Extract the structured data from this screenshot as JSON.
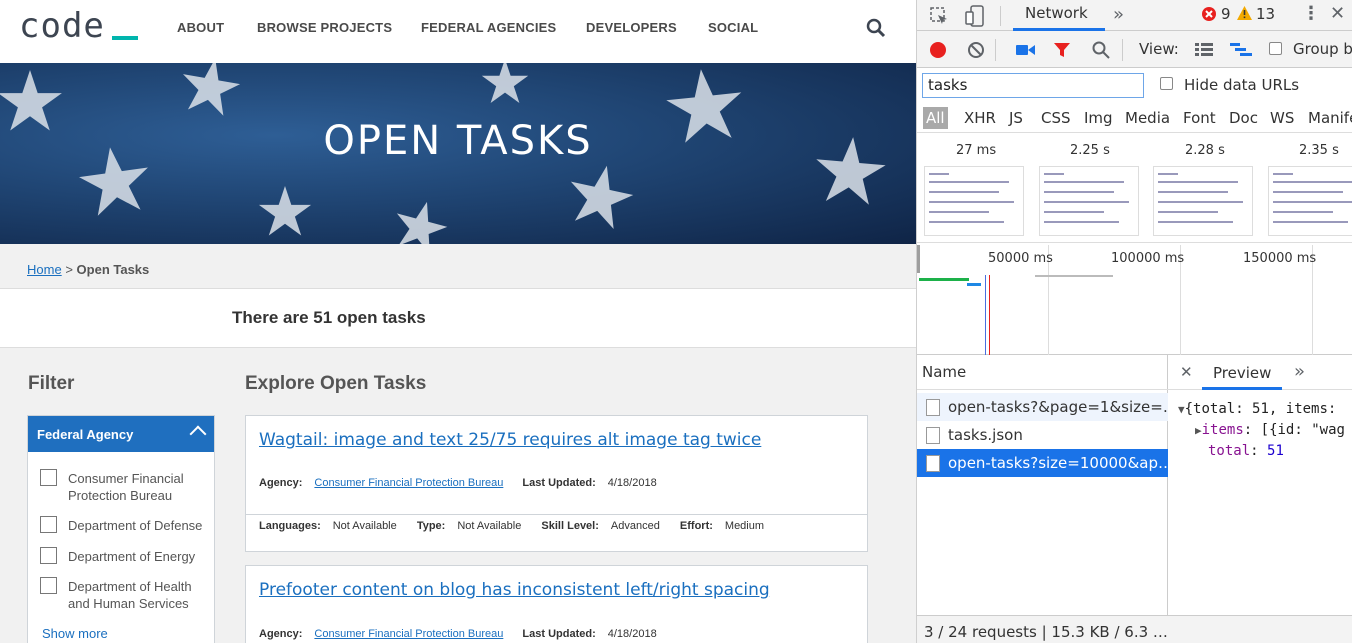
{
  "site": {
    "logo": "code",
    "nav": [
      "ABOUT",
      "BROWSE PROJECTS",
      "FEDERAL AGENCIES",
      "DEVELOPERS",
      "SOCIAL"
    ],
    "hero_title": "OPEN TASKS",
    "breadcrumb": {
      "home": "Home",
      "sep": ">",
      "current": "Open Tasks"
    },
    "count_text": "There are 51 open tasks",
    "filter": {
      "title": "Filter",
      "section": "Federal Agency",
      "options": [
        "Consumer Financial Protection Bureau",
        "Department of Defense",
        "Department of Energy",
        "Department of Health and Human Services"
      ],
      "show_more": "Show more"
    },
    "explore_title": "Explore Open Tasks",
    "tasks": [
      {
        "title": "Wagtail: image and text 25/75 requires alt image tag twice",
        "agency_label": "Agency:",
        "agency": "Consumer Financial Protection Bureau",
        "updated_label": "Last Updated:",
        "updated": "4/18/2018",
        "languages_label": "Languages:",
        "languages": "Not Available",
        "type_label": "Type:",
        "type": "Not Available",
        "skill_label": "Skill Level:",
        "skill": "Advanced",
        "effort_label": "Effort:",
        "effort": "Medium"
      },
      {
        "title": "Prefooter content on blog has inconsistent left/right spacing",
        "agency_label": "Agency:",
        "agency": "Consumer Financial Protection Bureau",
        "updated_label": "Last Updated:",
        "updated": "4/18/2018"
      }
    ]
  },
  "devtools": {
    "tab": "Network",
    "errors": "9",
    "warnings": "13",
    "view_label": "View:",
    "group_label": "Group by",
    "filter_value": "tasks",
    "hide_data_urls": "Hide data URLs",
    "types": [
      "All",
      "XHR",
      "JS",
      "CSS",
      "Img",
      "Media",
      "Font",
      "Doc",
      "WS",
      "Manife"
    ],
    "film_times": [
      "27 ms",
      "2.25 s",
      "2.28 s",
      "2.35 s"
    ],
    "timeline_labels": [
      "50000 ms",
      "100000 ms",
      "150000 ms"
    ],
    "name_header": "Name",
    "requests": [
      "open-tasks?&page=1&size=…",
      "tasks.json",
      "open-tasks?size=10000&ap…"
    ],
    "preview_tab": "Preview",
    "preview": {
      "line1": "{total: 51, items:",
      "items_key": "items",
      "items_val": ": [{id: \"wag",
      "total_key": "total",
      "total_val": "51"
    },
    "status": "3 / 24 requests  |  15.3 KB / 6.3 …",
    "colors": {
      "accent": "#1a73e8",
      "record": "#e8211f",
      "error": "#e8211f",
      "warning": "#f2a900"
    }
  }
}
